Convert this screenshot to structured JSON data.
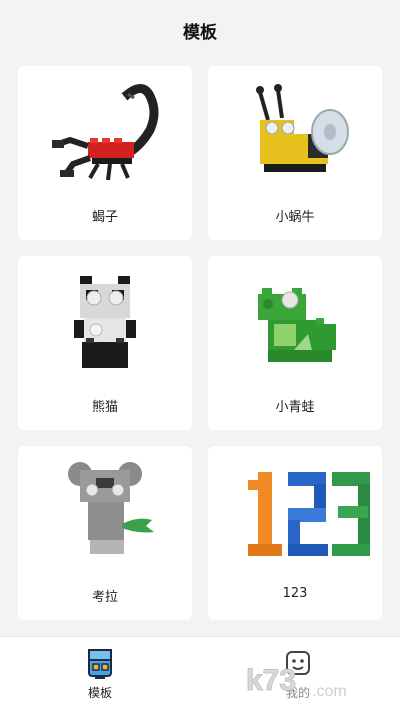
{
  "header": {
    "title": "模板"
  },
  "templates": [
    {
      "label": "蝎子"
    },
    {
      "label": "小蜗牛"
    },
    {
      "label": "熊猫"
    },
    {
      "label": "小青蛙"
    },
    {
      "label": "考拉"
    },
    {
      "label": "123"
    }
  ],
  "tabbar": {
    "tabs": [
      {
        "label": "模板",
        "icon": "template-box-icon",
        "active": true
      },
      {
        "label": "我的",
        "icon": "profile-face-icon",
        "active": false
      }
    ]
  },
  "watermark": {
    "text": "k73.com"
  }
}
